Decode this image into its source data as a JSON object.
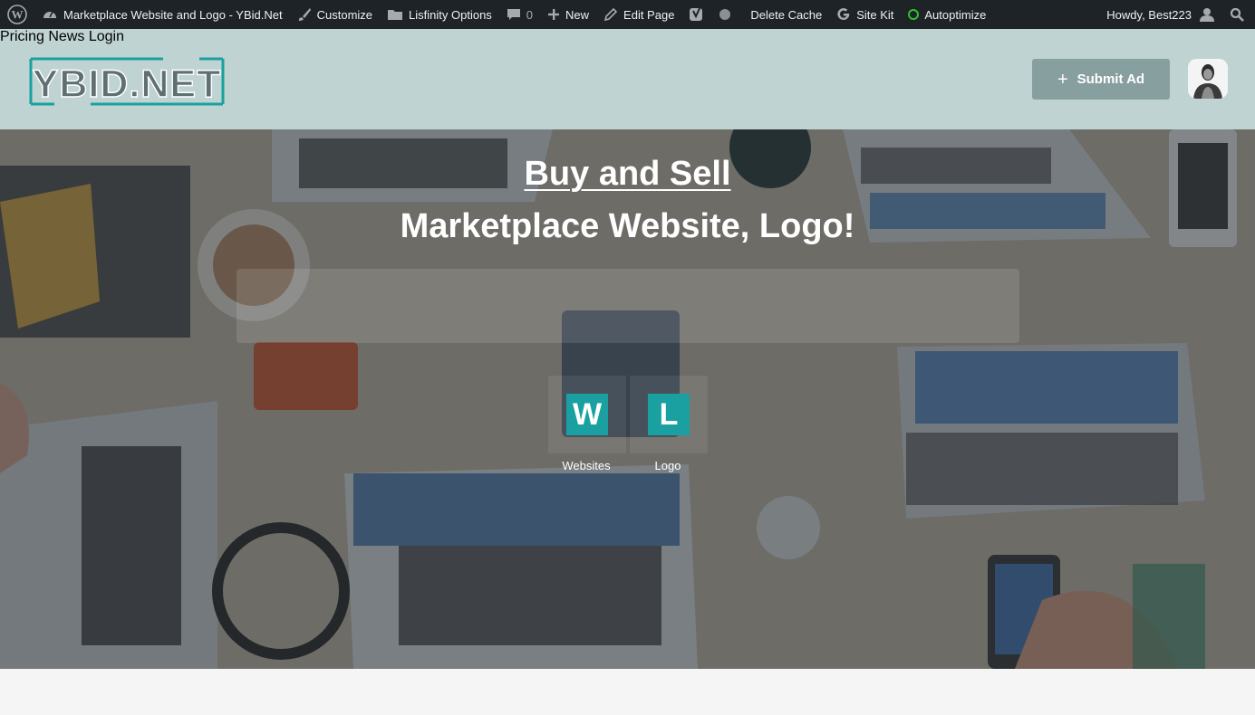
{
  "adminbar": {
    "site_title": "Marketplace Website and Logo - YBid.Net",
    "customize": "Customize",
    "theme_options": "Lisfinity Options",
    "comments_count": "0",
    "new": "New",
    "edit_page": "Edit Page",
    "delete_cache": "Delete Cache",
    "site_kit": "Site Kit",
    "autoptimize": "Autoptimize",
    "howdy": "Howdy, Best223"
  },
  "header": {
    "logo_text": "YBID.NET",
    "nav": [
      "Pricing",
      "News",
      "Login"
    ],
    "submit_label": "Submit Ad"
  },
  "hero": {
    "title_line1": "Buy and Sell",
    "title_line2": "Marketplace Website, Logo!",
    "search_placeholder": "",
    "categories": [
      {
        "letter": "W",
        "label": "Websites"
      },
      {
        "letter": "L",
        "label": "Logo"
      }
    ]
  },
  "colors": {
    "adminbar": "#1d2327",
    "header": "#bfd3d2",
    "accent": "#1aa0a0",
    "button": "#889f9f"
  }
}
